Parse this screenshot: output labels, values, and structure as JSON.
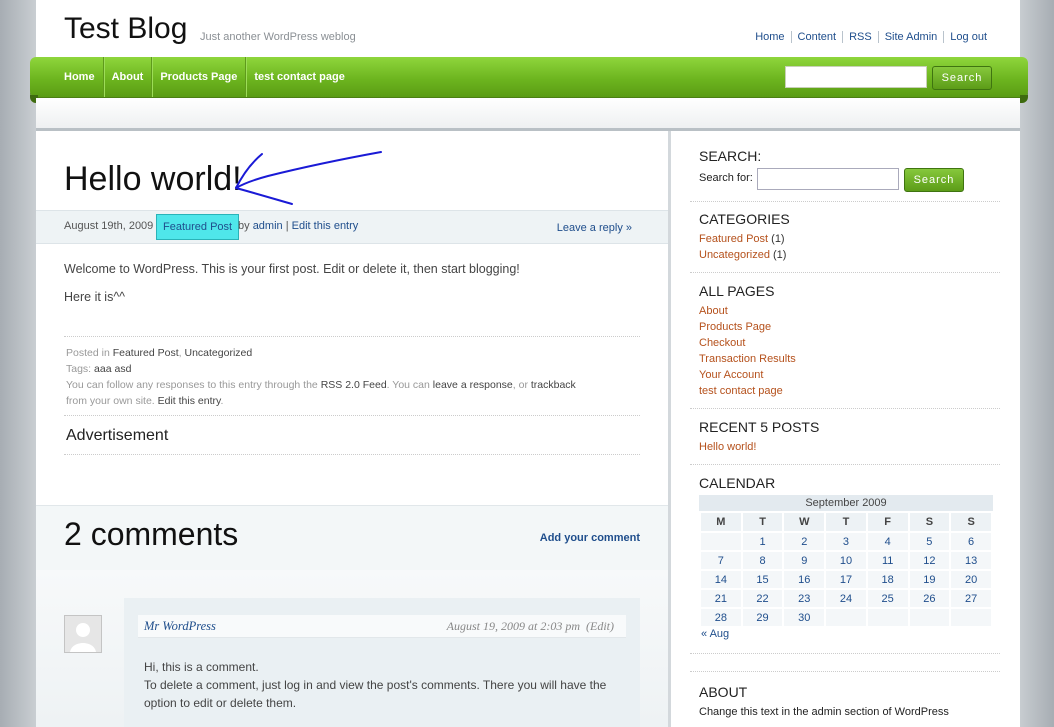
{
  "header": {
    "title": "Test Blog",
    "tagline": "Just another WordPress weblog",
    "links": [
      "Home",
      "Content",
      "RSS",
      "Site Admin",
      "Log out"
    ]
  },
  "nav": {
    "items": [
      "Home",
      "About",
      "Products Page",
      "test contact page"
    ],
    "search_button": "Search"
  },
  "post": {
    "title": "Hello world!",
    "date": "August 19th, 2009",
    "category_badge": "Featured Post",
    "by": "by",
    "author": "admin",
    "edit_link": "Edit this entry",
    "reply_link": "Leave a reply »",
    "paragraphs": [
      "Welcome to WordPress. This is your first post. Edit or delete it, then start blogging!",
      "Here it is^^"
    ],
    "footer": {
      "posted_in": "Posted in",
      "cat1": "Featured Post",
      "cat2": "Uncategorized",
      "tags_label": "Tags:",
      "tag1": "aaa",
      "tag2": "asd",
      "follow_text": "You can follow any responses to this entry through the",
      "rss_link": "RSS 2.0 Feed",
      "you_can": ". You can",
      "leave_response": "leave a response",
      "or": ", or",
      "trackback": "trackback",
      "from_site": "from your own site.",
      "edit": "Edit this entry"
    },
    "advertisement": "Advertisement"
  },
  "comments": {
    "count_title": "2 comments",
    "add_link": "Add your comment",
    "first": {
      "author": "Mr WordPress",
      "date": "August 19, 2009 at 2:03 pm",
      "edit": "(Edit)",
      "line1": "Hi, this is a comment.",
      "line2": "To delete a comment, just log in and view the post's comments. There you will have the option to edit or delete them."
    }
  },
  "sidebar": {
    "search_title": "SEARCH:",
    "search_label": "Search for:",
    "search_button": "Search",
    "categories_title": "CATEGORIES",
    "categories": [
      {
        "name": "Featured Post",
        "count": "(1)"
      },
      {
        "name": "Uncategorized",
        "count": "(1)"
      }
    ],
    "pages_title": "ALL PAGES",
    "pages": [
      "About",
      "Products Page",
      "Checkout",
      "Transaction Results",
      "Your Account",
      "test contact page"
    ],
    "recent_title": "RECENT 5 POSTS",
    "recent": [
      "Hello world!"
    ],
    "calendar_title": "CALENDAR",
    "calendar": {
      "caption": "September 2009",
      "days": [
        "M",
        "T",
        "W",
        "T",
        "F",
        "S",
        "S"
      ],
      "weeks": [
        [
          "",
          "1",
          "2",
          "3",
          "4",
          "5",
          "6"
        ],
        [
          "7",
          "8",
          "9",
          "10",
          "11",
          "12",
          "13"
        ],
        [
          "14",
          "15",
          "16",
          "17",
          "18",
          "19",
          "20"
        ],
        [
          "21",
          "22",
          "23",
          "24",
          "25",
          "26",
          "27"
        ],
        [
          "28",
          "29",
          "30",
          "",
          "",
          "",
          ""
        ]
      ],
      "prev": "« Aug"
    },
    "about_title": "ABOUT",
    "about_text": "Change this text in the admin section of WordPress"
  },
  "colors": {
    "nav_green": "#6db51f",
    "link_blue": "#1f4e8c",
    "sidebar_link": "#b5511c",
    "badge": "#4fe6ea",
    "annotation": "#1a1ad6"
  }
}
